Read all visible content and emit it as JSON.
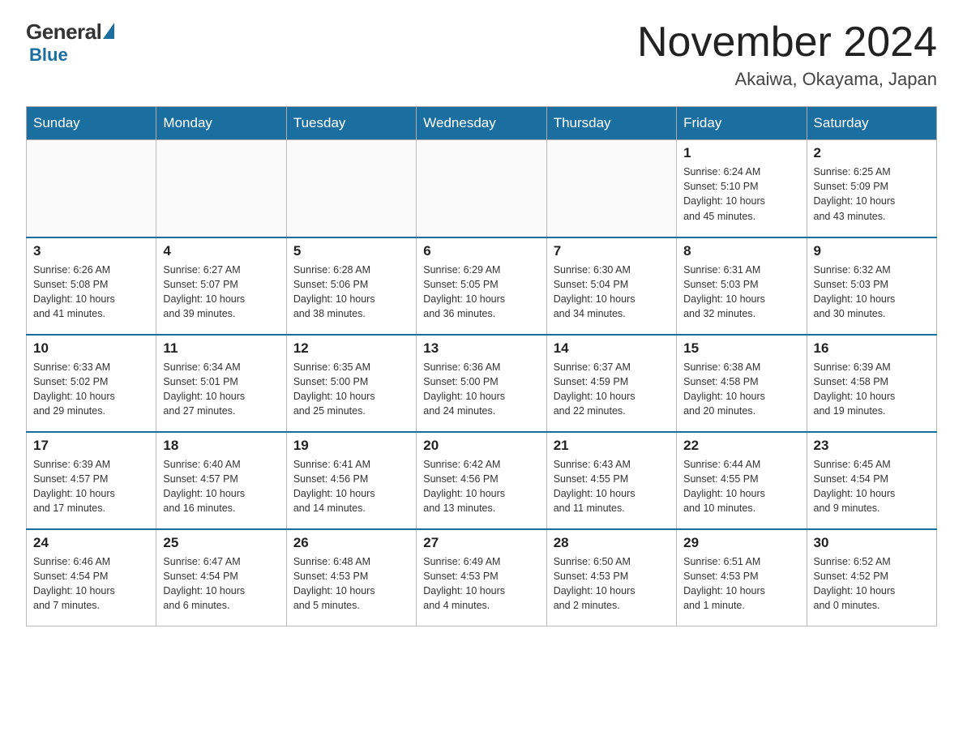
{
  "header": {
    "logo_general": "General",
    "logo_blue": "Blue",
    "month": "November 2024",
    "location": "Akaiwa, Okayama, Japan"
  },
  "weekdays": [
    "Sunday",
    "Monday",
    "Tuesday",
    "Wednesday",
    "Thursday",
    "Friday",
    "Saturday"
  ],
  "weeks": [
    [
      {
        "day": "",
        "info": ""
      },
      {
        "day": "",
        "info": ""
      },
      {
        "day": "",
        "info": ""
      },
      {
        "day": "",
        "info": ""
      },
      {
        "day": "",
        "info": ""
      },
      {
        "day": "1",
        "info": "Sunrise: 6:24 AM\nSunset: 5:10 PM\nDaylight: 10 hours\nand 45 minutes."
      },
      {
        "day": "2",
        "info": "Sunrise: 6:25 AM\nSunset: 5:09 PM\nDaylight: 10 hours\nand 43 minutes."
      }
    ],
    [
      {
        "day": "3",
        "info": "Sunrise: 6:26 AM\nSunset: 5:08 PM\nDaylight: 10 hours\nand 41 minutes."
      },
      {
        "day": "4",
        "info": "Sunrise: 6:27 AM\nSunset: 5:07 PM\nDaylight: 10 hours\nand 39 minutes."
      },
      {
        "day": "5",
        "info": "Sunrise: 6:28 AM\nSunset: 5:06 PM\nDaylight: 10 hours\nand 38 minutes."
      },
      {
        "day": "6",
        "info": "Sunrise: 6:29 AM\nSunset: 5:05 PM\nDaylight: 10 hours\nand 36 minutes."
      },
      {
        "day": "7",
        "info": "Sunrise: 6:30 AM\nSunset: 5:04 PM\nDaylight: 10 hours\nand 34 minutes."
      },
      {
        "day": "8",
        "info": "Sunrise: 6:31 AM\nSunset: 5:03 PM\nDaylight: 10 hours\nand 32 minutes."
      },
      {
        "day": "9",
        "info": "Sunrise: 6:32 AM\nSunset: 5:03 PM\nDaylight: 10 hours\nand 30 minutes."
      }
    ],
    [
      {
        "day": "10",
        "info": "Sunrise: 6:33 AM\nSunset: 5:02 PM\nDaylight: 10 hours\nand 29 minutes."
      },
      {
        "day": "11",
        "info": "Sunrise: 6:34 AM\nSunset: 5:01 PM\nDaylight: 10 hours\nand 27 minutes."
      },
      {
        "day": "12",
        "info": "Sunrise: 6:35 AM\nSunset: 5:00 PM\nDaylight: 10 hours\nand 25 minutes."
      },
      {
        "day": "13",
        "info": "Sunrise: 6:36 AM\nSunset: 5:00 PM\nDaylight: 10 hours\nand 24 minutes."
      },
      {
        "day": "14",
        "info": "Sunrise: 6:37 AM\nSunset: 4:59 PM\nDaylight: 10 hours\nand 22 minutes."
      },
      {
        "day": "15",
        "info": "Sunrise: 6:38 AM\nSunset: 4:58 PM\nDaylight: 10 hours\nand 20 minutes."
      },
      {
        "day": "16",
        "info": "Sunrise: 6:39 AM\nSunset: 4:58 PM\nDaylight: 10 hours\nand 19 minutes."
      }
    ],
    [
      {
        "day": "17",
        "info": "Sunrise: 6:39 AM\nSunset: 4:57 PM\nDaylight: 10 hours\nand 17 minutes."
      },
      {
        "day": "18",
        "info": "Sunrise: 6:40 AM\nSunset: 4:57 PM\nDaylight: 10 hours\nand 16 minutes."
      },
      {
        "day": "19",
        "info": "Sunrise: 6:41 AM\nSunset: 4:56 PM\nDaylight: 10 hours\nand 14 minutes."
      },
      {
        "day": "20",
        "info": "Sunrise: 6:42 AM\nSunset: 4:56 PM\nDaylight: 10 hours\nand 13 minutes."
      },
      {
        "day": "21",
        "info": "Sunrise: 6:43 AM\nSunset: 4:55 PM\nDaylight: 10 hours\nand 11 minutes."
      },
      {
        "day": "22",
        "info": "Sunrise: 6:44 AM\nSunset: 4:55 PM\nDaylight: 10 hours\nand 10 minutes."
      },
      {
        "day": "23",
        "info": "Sunrise: 6:45 AM\nSunset: 4:54 PM\nDaylight: 10 hours\nand 9 minutes."
      }
    ],
    [
      {
        "day": "24",
        "info": "Sunrise: 6:46 AM\nSunset: 4:54 PM\nDaylight: 10 hours\nand 7 minutes."
      },
      {
        "day": "25",
        "info": "Sunrise: 6:47 AM\nSunset: 4:54 PM\nDaylight: 10 hours\nand 6 minutes."
      },
      {
        "day": "26",
        "info": "Sunrise: 6:48 AM\nSunset: 4:53 PM\nDaylight: 10 hours\nand 5 minutes."
      },
      {
        "day": "27",
        "info": "Sunrise: 6:49 AM\nSunset: 4:53 PM\nDaylight: 10 hours\nand 4 minutes."
      },
      {
        "day": "28",
        "info": "Sunrise: 6:50 AM\nSunset: 4:53 PM\nDaylight: 10 hours\nand 2 minutes."
      },
      {
        "day": "29",
        "info": "Sunrise: 6:51 AM\nSunset: 4:53 PM\nDaylight: 10 hours\nand 1 minute."
      },
      {
        "day": "30",
        "info": "Sunrise: 6:52 AM\nSunset: 4:52 PM\nDaylight: 10 hours\nand 0 minutes."
      }
    ]
  ]
}
